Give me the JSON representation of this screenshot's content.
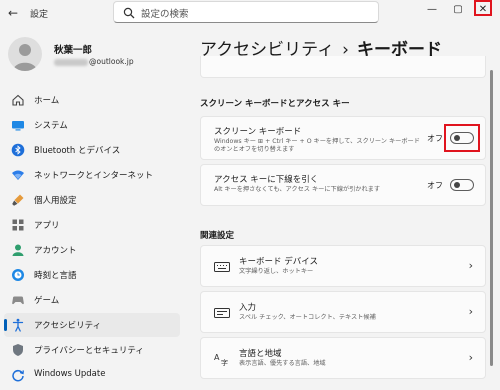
{
  "window": {
    "app_title": "設定",
    "back_icon": "←",
    "minimize": "—",
    "maximize": "▢",
    "close": "✕"
  },
  "search": {
    "placeholder": "設定の検索"
  },
  "profile": {
    "name": "秋葉一郎",
    "email_suffix": "@outlook.jp"
  },
  "sidebar": {
    "items": [
      {
        "label": "ホーム",
        "icon": "home-icon"
      },
      {
        "label": "システム",
        "icon": "system-icon"
      },
      {
        "label": "Bluetooth とデバイス",
        "icon": "bluetooth-icon"
      },
      {
        "label": "ネットワークとインターネット",
        "icon": "network-icon"
      },
      {
        "label": "個人用設定",
        "icon": "brush-icon"
      },
      {
        "label": "アプリ",
        "icon": "apps-icon"
      },
      {
        "label": "アカウント",
        "icon": "account-icon"
      },
      {
        "label": "時刻と言語",
        "icon": "time-language-icon"
      },
      {
        "label": "ゲーム",
        "icon": "gaming-icon"
      },
      {
        "label": "アクセシビリティ",
        "icon": "accessibility-icon",
        "active": true
      },
      {
        "label": "プライバシーとセキュリティ",
        "icon": "shield-icon"
      },
      {
        "label": "Windows Update",
        "icon": "update-icon"
      }
    ]
  },
  "header": {
    "parent": "アクセシビリティ",
    "separator": "›",
    "current": "キーボード"
  },
  "onscreen_section": {
    "heading": "スクリーン キーボードとアクセス キー",
    "screen_keyboard": {
      "title": "スクリーン キーボード",
      "desc_line1": "Windows キー ⊞ + Ctrl キー + O キーを押して、スクリーン キーボード",
      "desc_line2": "のオンとオフを切り替えます",
      "state": "オフ"
    },
    "access_keys": {
      "title": "アクセス キーに下線を引く",
      "desc": "Alt キーを押さなくても、アクセス キーに下線が引かれます",
      "state": "オフ"
    }
  },
  "related": {
    "heading": "関連設定",
    "items": [
      {
        "title": "キーボード デバイス",
        "desc": "文字繰り返し、ホットキー",
        "icon": "keyboard-icon"
      },
      {
        "title": "入力",
        "desc": "スペル チェック、オートコレクト、テキスト候補",
        "icon": "input-icon"
      },
      {
        "title": "言語と地域",
        "desc": "表示言語、優先する言語、地域",
        "icon": "language-region-icon"
      }
    ]
  },
  "colors": {
    "accent": "#005fb8",
    "highlight": "#e0141e",
    "background": "#f3f3f3",
    "card": "#fbfbfb"
  }
}
